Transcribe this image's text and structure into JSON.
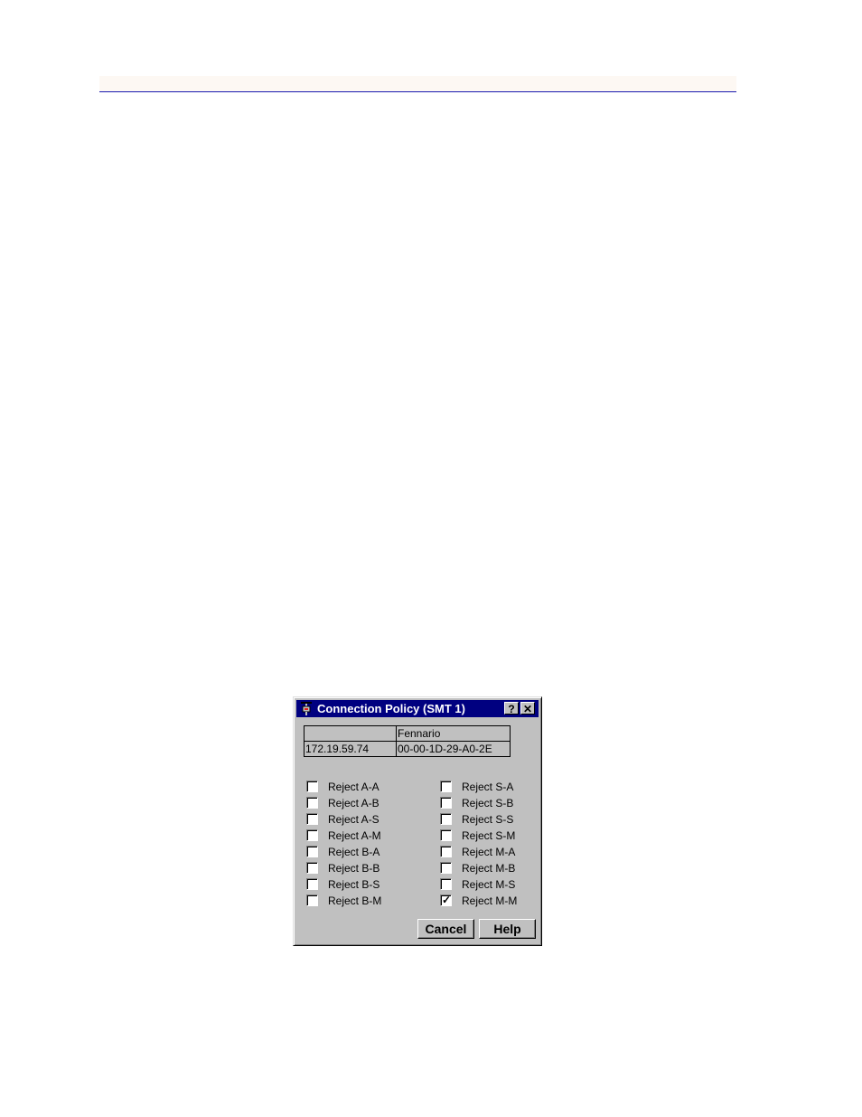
{
  "dialog": {
    "title": "Connection Policy (SMT 1)",
    "help_button": "?",
    "close_button": "✕",
    "table": {
      "row1": [
        "",
        "Fennario"
      ],
      "row2": [
        "172.19.59.74",
        "00-00-1D-29-A0-2E"
      ]
    },
    "checkboxes_left": [
      {
        "label": "Reject A-A",
        "checked": false
      },
      {
        "label": "Reject A-B",
        "checked": false
      },
      {
        "label": "Reject A-S",
        "checked": false
      },
      {
        "label": "Reject A-M",
        "checked": false
      },
      {
        "label": "Reject B-A",
        "checked": false
      },
      {
        "label": "Reject B-B",
        "checked": false
      },
      {
        "label": "Reject B-S",
        "checked": false
      },
      {
        "label": "Reject B-M",
        "checked": false
      }
    ],
    "checkboxes_right": [
      {
        "label": "Reject S-A",
        "checked": false
      },
      {
        "label": "Reject S-B",
        "checked": false
      },
      {
        "label": "Reject S-S",
        "checked": false
      },
      {
        "label": "Reject S-M",
        "checked": false
      },
      {
        "label": "Reject M-A",
        "checked": false
      },
      {
        "label": "Reject M-B",
        "checked": false
      },
      {
        "label": "Reject M-S",
        "checked": false
      },
      {
        "label": "Reject M-M",
        "checked": true
      }
    ],
    "cancel_label": "Cancel",
    "help_label": "Help",
    "check_glyph": "✓"
  },
  "colors": {
    "header_rule": "#1a1ab0",
    "titlebar": "#000080",
    "dialog_face": "#c0c0c0"
  }
}
